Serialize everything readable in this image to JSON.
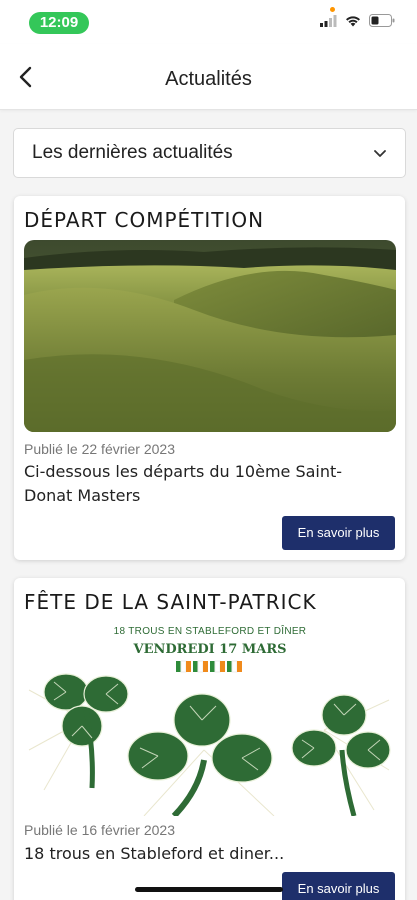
{
  "status_bar": {
    "time": "12:09"
  },
  "header": {
    "title": "Actualités"
  },
  "filter": {
    "selected": "Les dernières actualités"
  },
  "articles": [
    {
      "title": "DÉPART COMPÉTITION",
      "date": "Publié le 22 février 2023",
      "excerpt": "Ci-dessous les départs du 10ème Saint-Donat Masters",
      "button": "En savoir plus"
    },
    {
      "title": "FÊTE DE LA SAINT-PATRICK",
      "image_text": {
        "line1": "18 TROUS EN STABLEFORD ET DÎNER",
        "line2": "VENDREDI 17 MARS"
      },
      "date": "Publié le 16 février 2023",
      "excerpt": "18 trous en Stableford et diner...",
      "button": "En savoir plus"
    }
  ],
  "colors": {
    "time_pill": "#34c759",
    "button": "#1e2f6b",
    "shamrock": "#2e6b35"
  }
}
